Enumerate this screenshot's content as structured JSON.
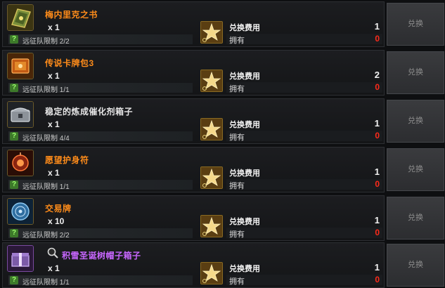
{
  "colors": {
    "item_name_orange": "#ff8c1a",
    "item_name_purple": "#c867ff",
    "owned_red": "#ff2a1a",
    "button_text": "#8e8e8e"
  },
  "items": [
    {
      "name": "梅内里克之书",
      "rarity": "legendary-orange",
      "icon": "book-icon",
      "quantity": "x 1",
      "limit_text": "远征队限制 2/2",
      "cost_label": "兑换费用",
      "cost_value": "1",
      "own_label": "拥有",
      "own_value": "0",
      "button_label": "兑换"
    },
    {
      "name": "传说卡牌包3",
      "rarity": "legendary-orange",
      "icon": "card-pack-icon",
      "quantity": "x 1",
      "limit_text": "远征队限制 1/1",
      "cost_label": "兑换费用",
      "cost_value": "2",
      "own_label": "拥有",
      "own_value": "0",
      "button_label": "兑换"
    },
    {
      "name": "稳定的炼成催化剂箱子",
      "rarity": "legendary-orange",
      "icon": "chest-icon",
      "quantity": "x 1",
      "limit_text": "远征队限制 4/4",
      "cost_label": "兑换费用",
      "cost_value": "1",
      "own_label": "拥有",
      "own_value": "0",
      "button_label": "兑换"
    },
    {
      "name": "愿望护身符",
      "rarity": "legendary-orange",
      "icon": "amulet-icon",
      "quantity": "x 1",
      "limit_text": "远征队限制 1/1",
      "cost_label": "兑换费用",
      "cost_value": "1",
      "own_label": "拥有",
      "own_value": "0",
      "button_label": "兑换"
    },
    {
      "name": "交易牌",
      "rarity": "legendary-orange",
      "icon": "trade-token-icon",
      "quantity": "x 10",
      "limit_text": "远征队限制 2/2",
      "cost_label": "兑换费用",
      "cost_value": "1",
      "own_label": "拥有",
      "own_value": "0",
      "button_label": "兑换"
    },
    {
      "name": "积雪圣诞树帽子箱子",
      "rarity": "epic-purple",
      "icon": "hat-box-icon",
      "quantity": "x 1",
      "limit_text": "远征队限制 1/1",
      "cost_label": "兑换费用",
      "cost_value": "1",
      "own_label": "拥有",
      "own_value": "0",
      "button_label": "兑换"
    }
  ]
}
